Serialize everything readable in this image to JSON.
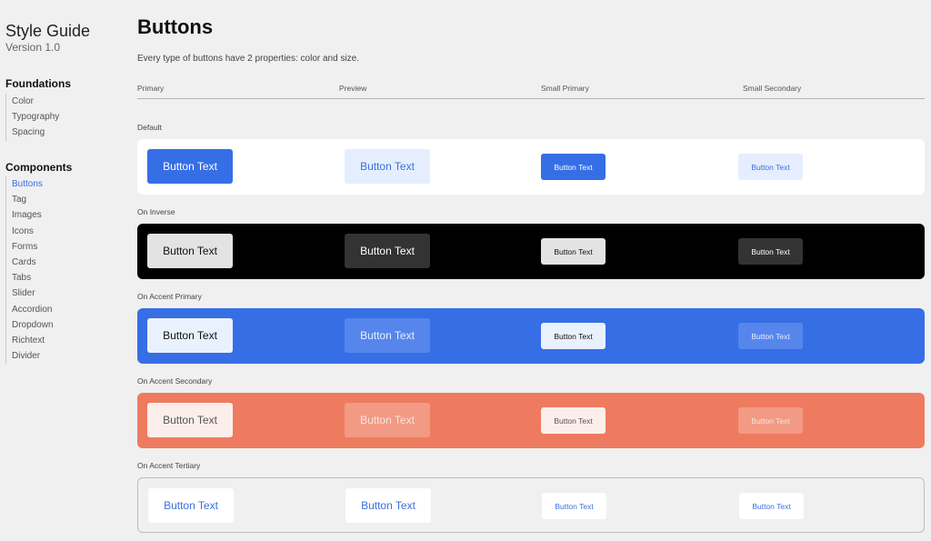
{
  "sidebar": {
    "title": "Style Guide",
    "version": "Version 1.0",
    "foundations": {
      "heading": "Foundations",
      "items": [
        "Color",
        "Typography",
        "Spacing"
      ]
    },
    "components": {
      "heading": "Components",
      "active": "Buttons",
      "items": [
        "Buttons",
        "Tag",
        "Images",
        "Icons",
        "Forms",
        "Cards",
        "Tabs",
        "Slider",
        "Accordion",
        "Dropdown",
        "Richtext",
        "Divider"
      ]
    }
  },
  "main": {
    "title": "Buttons",
    "description": "Every type of buttons have 2 properties: color and size.",
    "columns": [
      "Primary",
      "Preview",
      "Small Primary",
      "Small Secondary"
    ],
    "groups": [
      {
        "label": "Default",
        "buttons": [
          "Button Text",
          "Button Text",
          "Button Text",
          "Button Text"
        ]
      },
      {
        "label": "On Inverse",
        "buttons": [
          "Button Text",
          "Button Text",
          "Button Text",
          "Button Text"
        ]
      },
      {
        "label": "On Accent Primary",
        "buttons": [
          "Button Text",
          "Button Text",
          "Button Text",
          "Button Text"
        ]
      },
      {
        "label": "On Accent Secondary",
        "buttons": [
          "Button Text",
          "Button Text",
          "Button Text",
          "Button Text"
        ]
      },
      {
        "label": "On Accent Tertiary",
        "buttons": [
          "Button Text",
          "Button Text",
          "Button Text",
          "Button Text"
        ]
      }
    ]
  },
  "colors": {
    "accent_primary": "#366ee6",
    "accent_secondary": "#ee7b5f",
    "inverse": "#000000",
    "link_active": "#3b6fe0"
  }
}
